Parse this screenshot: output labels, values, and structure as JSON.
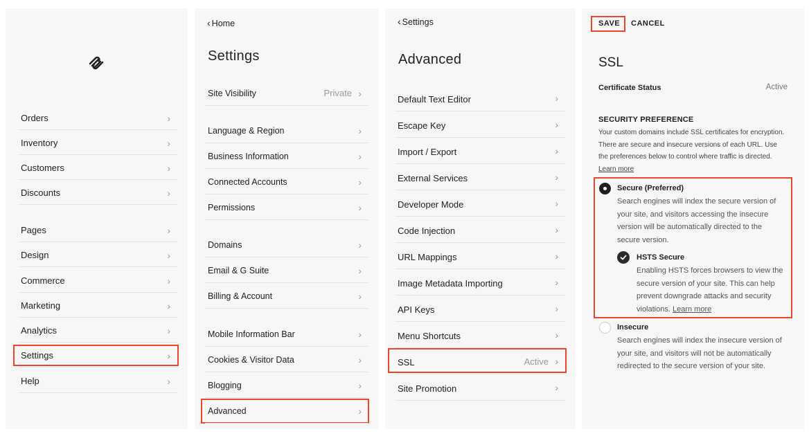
{
  "main_menu": {
    "group1": [
      "Orders",
      "Inventory",
      "Customers",
      "Discounts"
    ],
    "group2": [
      "Pages",
      "Design",
      "Commerce",
      "Marketing",
      "Analytics",
      "Settings",
      "Help"
    ]
  },
  "settings": {
    "back_label": "Home",
    "title": "Settings",
    "site_visibility": {
      "label": "Site Visibility",
      "value": "Private"
    },
    "group1": [
      "Language & Region",
      "Business Information",
      "Connected Accounts",
      "Permissions"
    ],
    "group2": [
      "Domains",
      "Email & G Suite",
      "Billing & Account"
    ],
    "group3": [
      "Mobile Information Bar",
      "Cookies & Visitor Data",
      "Blogging",
      "Advanced"
    ]
  },
  "advanced": {
    "back_label": "Settings",
    "title": "Advanced",
    "items": [
      {
        "label": "Default Text Editor",
        "value": ""
      },
      {
        "label": "Escape Key",
        "value": ""
      },
      {
        "label": "Import / Export",
        "value": ""
      },
      {
        "label": "External Services",
        "value": ""
      },
      {
        "label": "Developer Mode",
        "value": ""
      },
      {
        "label": "Code Injection",
        "value": ""
      },
      {
        "label": "URL Mappings",
        "value": ""
      },
      {
        "label": "Image Metadata Importing",
        "value": ""
      },
      {
        "label": "API Keys",
        "value": ""
      },
      {
        "label": "Menu Shortcuts",
        "value": ""
      },
      {
        "label": "SSL",
        "value": "Active"
      },
      {
        "label": "Site Promotion",
        "value": ""
      }
    ]
  },
  "ssl": {
    "save_label": "SAVE",
    "cancel_label": "CANCEL",
    "title": "SSL",
    "certificate_status_label": "Certificate Status",
    "certificate_status_value": "Active",
    "security_header": "SECURITY PREFERENCE",
    "security_desc": "Your custom domains include SSL certificates for encryption. There are secure and insecure versions of each URL. Use the preferences below to control where traffic is directed.",
    "learn_more": "Learn more",
    "secure_title": "Secure (Preferred)",
    "secure_desc": "Search engines will index the secure version of your site, and visitors accessing the insecure version will be automatically directed to the secure version.",
    "hsts_title": "HSTS Secure",
    "hsts_desc": "Enabling HSTS forces browsers to view the secure version of your site. This can help prevent downgrade attacks and security violations.",
    "insecure_title": "Insecure",
    "insecure_desc": "Search engines will index the insecure version of your site, and visitors will not be automatically redirected to the secure version of your site.",
    "secure_selected": true,
    "hsts_checked": true
  },
  "colors": {
    "highlight": "#e8472d",
    "panel_bg": "#f7f7f7"
  }
}
